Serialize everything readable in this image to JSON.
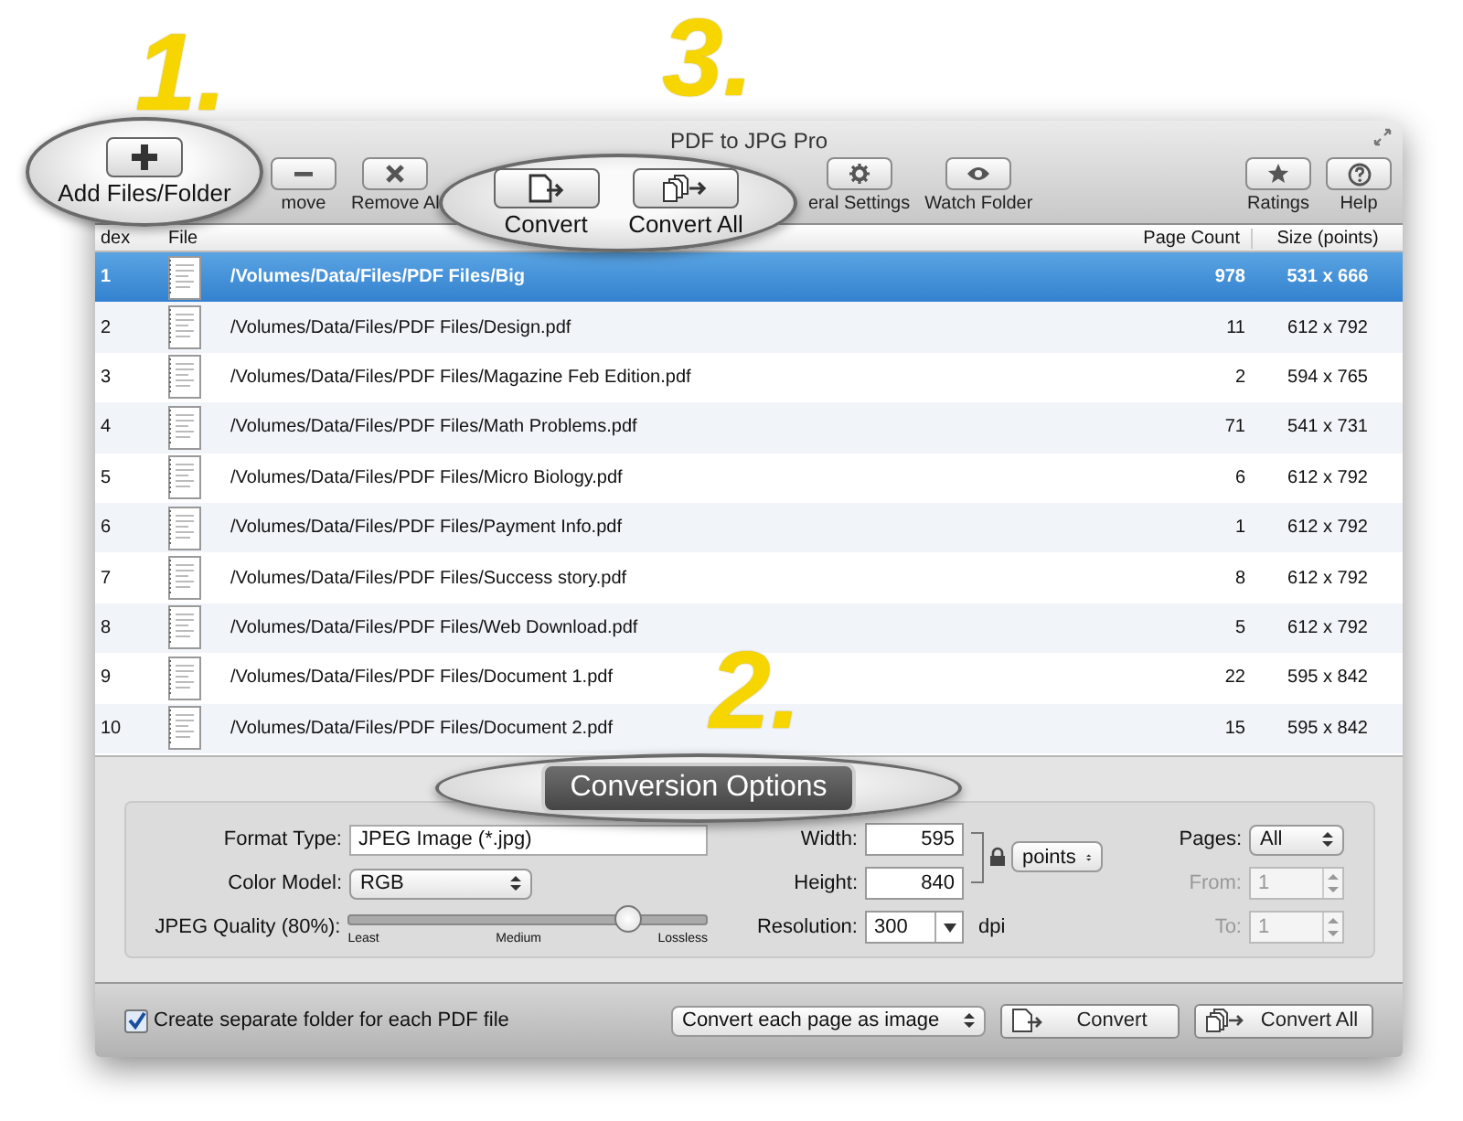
{
  "window": {
    "title": "PDF to JPG Pro"
  },
  "toolbar": {
    "left": [
      {
        "kind": "minus",
        "label": "move"
      },
      {
        "kind": "cross",
        "label": "Remove Al"
      }
    ],
    "middle": [
      {
        "kind": "gear",
        "label": "eral Settings"
      },
      {
        "kind": "eye",
        "label": "Watch Folder"
      }
    ],
    "right": [
      {
        "kind": "star",
        "label": "Ratings"
      },
      {
        "kind": "question",
        "label": "Help"
      }
    ]
  },
  "callout_add": {
    "number": "1.",
    "label": "Add Files/Folder"
  },
  "callout_convert": {
    "number": "3.",
    "buttons": [
      {
        "kind": "single",
        "label": "Convert"
      },
      {
        "kind": "multi",
        "label": "Convert All"
      }
    ]
  },
  "callout_options": {
    "number": "2.",
    "label": "Conversion Options"
  },
  "table": {
    "columns": [
      "dex",
      "File",
      "Page Count",
      "Size (points)"
    ],
    "rows": [
      {
        "index": "1",
        "path": "/Volumes/Data/Files/PDF Files/Big",
        "pages": "978",
        "size": "531 x 666",
        "selected": true
      },
      {
        "index": "2",
        "path": "/Volumes/Data/Files/PDF Files/Design.pdf",
        "pages": "11",
        "size": "612 x 792",
        "selected": false
      },
      {
        "index": "3",
        "path": "/Volumes/Data/Files/PDF Files/Magazine Feb Edition.pdf",
        "pages": "2",
        "size": "594 x 765",
        "selected": false
      },
      {
        "index": "4",
        "path": "/Volumes/Data/Files/PDF Files/Math Problems.pdf",
        "pages": "71",
        "size": "541 x 731",
        "selected": false
      },
      {
        "index": "5",
        "path": "/Volumes/Data/Files/PDF Files/Micro Biology.pdf",
        "pages": "6",
        "size": "612 x 792",
        "selected": false
      },
      {
        "index": "6",
        "path": "/Volumes/Data/Files/PDF Files/Payment Info.pdf",
        "pages": "1",
        "size": "612 x 792",
        "selected": false
      },
      {
        "index": "7",
        "path": "/Volumes/Data/Files/PDF Files/Success story.pdf",
        "pages": "8",
        "size": "612 x 792",
        "selected": false
      },
      {
        "index": "8",
        "path": "/Volumes/Data/Files/PDF Files/Web Download.pdf",
        "pages": "5",
        "size": "612 x 792",
        "selected": false
      },
      {
        "index": "9",
        "path": "/Volumes/Data/Files/PDF Files/Document 1.pdf",
        "pages": "22",
        "size": "595 x 842",
        "selected": false
      },
      {
        "index": "10",
        "path": "/Volumes/Data/Files/PDF Files/Document 2.pdf",
        "pages": "15",
        "size": "595 x 842",
        "selected": false
      }
    ]
  },
  "options": {
    "format_type": {
      "label": "Format Type:",
      "value": "JPEG Image (*.jpg)"
    },
    "color_model": {
      "label": "Color Model:",
      "value": "RGB"
    },
    "quality": {
      "label": "JPEG Quality (80%):",
      "level": 0.78,
      "ticks": [
        "Least",
        "Medium",
        "Lossless"
      ]
    },
    "width": {
      "label": "Width:",
      "value": "595"
    },
    "height": {
      "label": "Height:",
      "value": "840"
    },
    "unit": {
      "value": "points"
    },
    "resolution": {
      "label": "Resolution:",
      "value": "300",
      "unit": "dpi"
    },
    "pages": {
      "label": "Pages:",
      "value": "All"
    },
    "from": {
      "label": "From:",
      "value": "1",
      "disabled": true
    },
    "to": {
      "label": "To:",
      "value": "1",
      "disabled": true
    }
  },
  "bottom": {
    "separate_folder": {
      "label": "Create separate folder for each PDF file",
      "checked": true
    },
    "mode": {
      "value": "Convert each page as image"
    },
    "buttons": [
      {
        "kind": "single",
        "label": "Convert"
      },
      {
        "kind": "multi",
        "label": "Convert All"
      }
    ]
  }
}
